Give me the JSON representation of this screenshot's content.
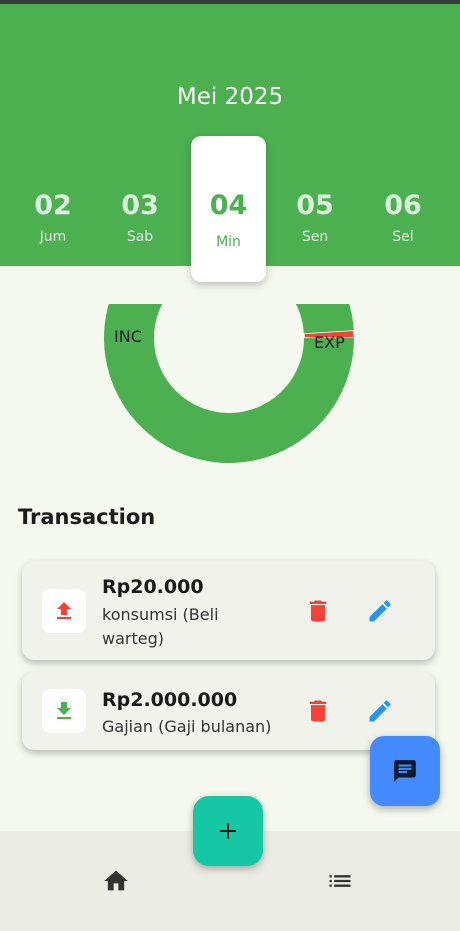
{
  "header": {
    "month_title": "Mei 2025",
    "days": [
      {
        "num": "02",
        "name": "Jum"
      },
      {
        "num": "03",
        "name": "Sab"
      },
      {
        "num": "04",
        "name": "Min",
        "selected": true
      },
      {
        "num": "05",
        "name": "Sen"
      },
      {
        "num": "06",
        "name": "Sel"
      }
    ]
  },
  "summary_chart": {
    "segments": [
      {
        "label": "INC",
        "value": 2000000,
        "color": "#4caf50"
      },
      {
        "label": "EXP",
        "value": 20000,
        "color": "#f44336"
      }
    ]
  },
  "transactions": {
    "title": "Transaction",
    "items": [
      {
        "type": "expense",
        "amount": "Rp20.000",
        "description": "konsumsi (Beli warteg)",
        "icon": "upload-icon",
        "icon_color": "#f44336"
      },
      {
        "type": "income",
        "amount": "Rp2.000.000",
        "description": "Gajian (Gaji bulanan)",
        "icon": "download-icon",
        "icon_color": "#4caf50"
      }
    ]
  },
  "colors": {
    "primary": "#4caf50",
    "delete": "#f44336",
    "edit": "#2196f3",
    "chat_fab": "#448aff",
    "add_fab": "#16c7a5"
  },
  "icons": {
    "chat": "chat-icon",
    "add": "plus-icon",
    "nav_home": "home-icon",
    "nav_list": "list-icon"
  }
}
